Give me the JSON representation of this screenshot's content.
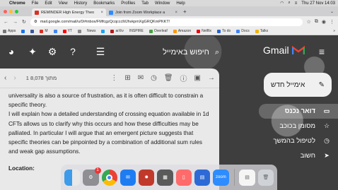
{
  "menubar": {
    "app": "Chrome",
    "items": [
      "File",
      "Edit",
      "View",
      "History",
      "Bookmarks",
      "Profiles",
      "Tab",
      "Window",
      "Help"
    ],
    "clock": "Thu 27 Nov  14:03"
  },
  "tabs": [
    {
      "title": "REMINDER High Energy Theo",
      "favicon_color": "#d93025"
    },
    {
      "title": "Join from Zoom Workplace a",
      "favicon_color": "#2d8cff"
    }
  ],
  "address": {
    "url": "mail.google.com/mail/u/0/#inbox/FMfcgzQcqcccMJhvkpmXgGRQKmPKKT!"
  },
  "bookmarks": [
    {
      "label": "Apps",
      "color": "#777"
    },
    {
      "label": "",
      "color": "#1a73e8"
    },
    {
      "label": "",
      "color": "#3b5998"
    },
    {
      "label": "M",
      "color": "#d93025"
    },
    {
      "label": "",
      "color": "#4285f4"
    },
    {
      "label": "YT",
      "color": "#ff0000"
    },
    {
      "label": "",
      "color": "#888"
    },
    {
      "label": "News",
      "color": "#555"
    },
    {
      "label": "",
      "color": "#1da1f2"
    },
    {
      "label": "arXiv",
      "color": "#b31b1b"
    },
    {
      "label": "INSPIRE",
      "color": "#1e5aa8"
    },
    {
      "label": "Overleaf",
      "color": "#47a141"
    },
    {
      "label": "Amazon",
      "color": "#ff9900"
    },
    {
      "label": "Netflix",
      "color": "#e50914"
    },
    {
      "label": "To do",
      "color": "#2564cf"
    },
    {
      "label": "Docs",
      "color": "#4285f4"
    },
    {
      "label": "Talks",
      "color": "#f4b400"
    }
  ],
  "gmail": {
    "search_placeholder": "חיפוש באימייל",
    "logo_text": "Gmail",
    "compose_label": "אימייל חדש",
    "page_count": "1 מתוך 8,078",
    "nav": [
      {
        "label": "דואר נכנס",
        "icon": "inbox-icon",
        "selected": true
      },
      {
        "label": "מסומן בכוכב",
        "icon": "star-icon"
      },
      {
        "label": "לטיפול בהמשך",
        "icon": "clock-icon"
      },
      {
        "label": "חשוב",
        "icon": "label-important-icon"
      }
    ]
  },
  "message": {
    "paragraphs": [
      "universality is also a source of frustration, as it is often difficult to constrain a specific theory.",
      "I will explain how a detailed understanding of crossing equation available in 1d CFTs allows us to clarify why this occurs and how these difficulties may be palliated. In particular I will argue that an emergent picture suggests that specific theories can be pinpointed by a combination of additional sum rules and weak gap assumptions.",
      "Location:"
    ]
  },
  "dock": {
    "apps": [
      {
        "name": "finder",
        "color": "#3d9be9"
      },
      {
        "name": "system-settings",
        "color": "#8e8e93",
        "badge": "1"
      },
      {
        "name": "chrome",
        "color": "#ffffff"
      },
      {
        "name": "mail",
        "color": "#1e7cf2"
      },
      {
        "name": "game",
        "color": "#c0392b"
      },
      {
        "name": "calculator",
        "color": "#5a5a5a"
      },
      {
        "name": "phone",
        "color": "#ff6b6b"
      },
      {
        "name": "files",
        "color": "#2d6ad6"
      },
      {
        "name": "zoom",
        "color": "#2d8cff",
        "label": "zoom"
      },
      {
        "name": "document",
        "color": "#f5f5f5"
      },
      {
        "name": "trash",
        "color": "#cfd3d8"
      }
    ]
  }
}
